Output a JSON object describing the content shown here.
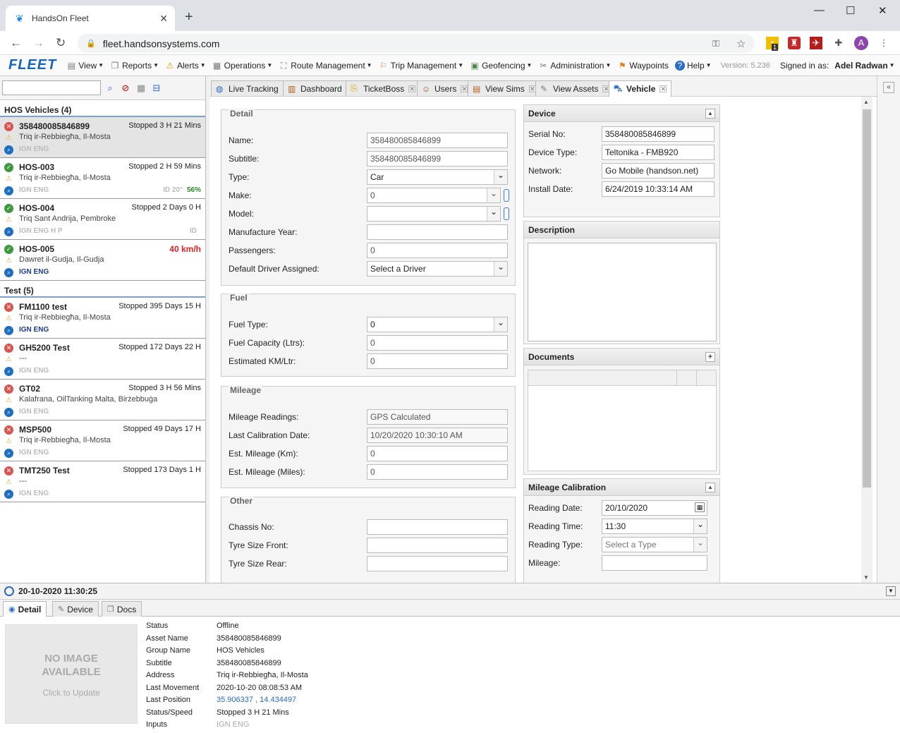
{
  "browser": {
    "tab_title": "HandsOn Fleet",
    "url": "fleet.handsonsystems.com",
    "profile_initial": "A",
    "ext_badge": "1"
  },
  "app": {
    "logo": "FLEET",
    "menu": [
      {
        "label": "View",
        "icon": "view-icon"
      },
      {
        "label": "Reports",
        "icon": "reports-icon"
      },
      {
        "label": "Alerts",
        "icon": "alerts-icon"
      },
      {
        "label": "Operations",
        "icon": "operations-icon"
      },
      {
        "label": "Route Management",
        "icon": "route-icon"
      },
      {
        "label": "Trip Management",
        "icon": "trip-icon"
      },
      {
        "label": "Geofencing",
        "icon": "geofencing-icon"
      },
      {
        "label": "Administration",
        "icon": "administration-icon"
      },
      {
        "label": "Waypoints",
        "icon": "waypoints-icon"
      },
      {
        "label": "Help",
        "icon": "help-icon"
      }
    ],
    "version": "Version: 5.236",
    "signed_in_label": "Signed in as:",
    "user": "Adel Radwan"
  },
  "sidebar": {
    "search_value": "",
    "groups": [
      {
        "title": "HOS Vehicles (4)",
        "vehicles": [
          {
            "name": "358480085846899",
            "status": "Stopped 3 H 21 Mins",
            "address": "Triq ir-Rebbiegħa, Il-Mosta",
            "ign": "IGN ENG",
            "extra": "",
            "pct": "",
            "online": false,
            "ign_on": false,
            "selected": true,
            "red": false
          },
          {
            "name": "HOS-003",
            "status": "Stopped 2 H 59 Mins",
            "address": "Triq ir-Rebbiegħa, Il-Mosta",
            "ign": "IGN ENG",
            "extra": "ID 20°",
            "pct": "56%",
            "online": true,
            "ign_on": false,
            "selected": false,
            "red": false
          },
          {
            "name": "HOS-004",
            "status": "Stopped 2 Days 0 H",
            "address": "Triq Sant Andrija, Pembroke",
            "ign": "IGN ENG H P",
            "extra": "ID",
            "pct": "",
            "online": true,
            "ign_on": false,
            "selected": false,
            "red": false
          },
          {
            "name": "HOS-005",
            "status": "40 km/h",
            "address": "Dawret il-Gudja, Il-Gudja",
            "ign": "IGN ENG",
            "extra": "",
            "pct": "",
            "online": true,
            "ign_on": true,
            "selected": false,
            "red": true
          }
        ]
      },
      {
        "title": "Test (5)",
        "vehicles": [
          {
            "name": "FM1100 test",
            "status": "Stopped 395 Days 15 H",
            "address": "Triq ir-Rebbiegħa, Il-Mosta",
            "ign": "IGN ENG",
            "extra": "",
            "pct": "",
            "online": false,
            "ign_on": true,
            "selected": false,
            "red": false
          },
          {
            "name": "GH5200 Test",
            "status": "Stopped 172 Days 22 H",
            "address": "---",
            "ign": "IGN ENG",
            "extra": "",
            "pct": "",
            "online": false,
            "ign_on": false,
            "selected": false,
            "red": false
          },
          {
            "name": "GT02",
            "status": "Stopped 3 H 56 Mins",
            "address": "Kalafrana, OilTanking Malta, Birżebbuġa",
            "ign": "IGN ENG",
            "extra": "",
            "pct": "",
            "online": false,
            "ign_on": false,
            "selected": false,
            "red": false
          },
          {
            "name": "MSP500",
            "status": "Stopped 49 Days 17 H",
            "address": "Triq ir-Rebbiegħa, Il-Mosta",
            "ign": "IGN ENG",
            "extra": "",
            "pct": "",
            "online": false,
            "ign_on": false,
            "selected": false,
            "red": false
          },
          {
            "name": "TMT250 Test",
            "status": "Stopped 173 Days 1 H",
            "address": "---",
            "ign": "IGN ENG",
            "extra": "",
            "pct": "",
            "online": false,
            "ign_on": false,
            "selected": false,
            "red": false
          }
        ]
      }
    ]
  },
  "doc_tabs": [
    "Live Tracking",
    "Dashboard",
    "TicketBoss",
    "Users",
    "View Sims",
    "View Assets",
    "Vehicle"
  ],
  "form": {
    "detail": {
      "legend": "Detail",
      "name_label": "Name:",
      "name": "358480085846899",
      "subtitle_label": "Subtitle:",
      "subtitle": "358480085846899",
      "type_label": "Type:",
      "type": "Car",
      "make_label": "Make:",
      "make": "0",
      "model_label": "Model:",
      "model": "",
      "year_label": "Manufacture Year:",
      "year": "",
      "passengers_label": "Passengers:",
      "passengers": "0",
      "driver_label": "Default Driver Assigned:",
      "driver": "Select a Driver"
    },
    "fuel": {
      "legend": "Fuel",
      "type_label": "Fuel Type:",
      "type": "0",
      "capacity_label": "Fuel Capacity (Ltrs):",
      "capacity": "0",
      "kml_label": "Estimated KM/Ltr:",
      "kml": "0"
    },
    "mileage": {
      "legend": "Mileage",
      "readings_label": "Mileage Readings:",
      "readings": "GPS Calculated",
      "calib_label": "Last Calibration Date:",
      "calib": "10/20/2020 10:30:10 AM",
      "km_label": "Est. Mileage (Km):",
      "km": "0",
      "miles_label": "Est. Mileage (Miles):",
      "miles": "0"
    },
    "other": {
      "legend": "Other",
      "chassis_label": "Chassis No:",
      "chassis": "",
      "front_label": "Tyre Size Front:",
      "front": "",
      "rear_label": "Tyre Size Rear:",
      "rear": ""
    }
  },
  "device": {
    "title": "Device",
    "serial_label": "Serial No:",
    "serial": "358480085846899",
    "type_label": "Device Type:",
    "type": "Teltonika - FMB920",
    "network_label": "Network:",
    "network": "Go Mobile (handson.net)",
    "install_label": "Install Date:",
    "install": "6/24/2019 10:33:14 AM"
  },
  "description": {
    "title": "Description",
    "text": ""
  },
  "documents": {
    "title": "Documents"
  },
  "calibration": {
    "title": "Mileage Calibration",
    "date_label": "Reading Date:",
    "date": "20/10/2020",
    "time_label": "Reading Time:",
    "time": "11:30",
    "type_label": "Reading Type:",
    "type_placeholder": "Select a Type",
    "mileage_label": "Mileage:",
    "mileage": ""
  },
  "bottom": {
    "datetime": "20-10-2020 11:30:25",
    "tabs": [
      "Detail",
      "Device",
      "Docs"
    ],
    "noimage_line1": "NO IMAGE",
    "noimage_line2": "AVAILABLE",
    "noimage_hint": "Click to Update",
    "rows": [
      {
        "k": "Status",
        "v": "Offline",
        "style": ""
      },
      {
        "k": "Asset Name",
        "v": "358480085846899",
        "style": ""
      },
      {
        "k": "Group Name",
        "v": "HOS Vehicles",
        "style": ""
      },
      {
        "k": "Subtitle",
        "v": "358480085846899",
        "style": ""
      },
      {
        "k": "Address",
        "v": "Triq ir-Rebbiegħa, Il-Mosta",
        "style": ""
      },
      {
        "k": "Last Movement",
        "v": "2020-10-20 08:08:53 AM",
        "style": ""
      },
      {
        "k": "Last Position",
        "v": "35.906337 , 14.434497",
        "style": "link"
      },
      {
        "k": "Status/Speed",
        "v": "Stopped 3 H 21 Mins",
        "style": ""
      },
      {
        "k": "Inputs",
        "v": "IGN ENG",
        "style": "grey"
      }
    ]
  }
}
